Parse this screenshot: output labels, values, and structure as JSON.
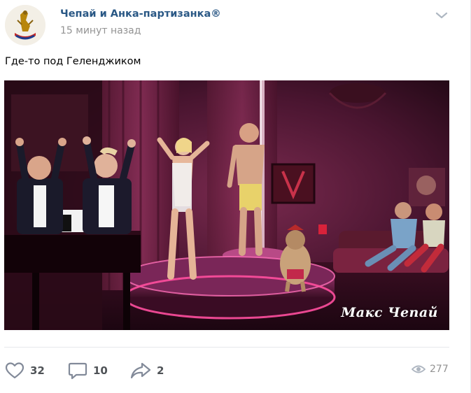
{
  "post": {
    "author": "Чепай и Анка-партизанка®",
    "time": "15 минут назад",
    "text": "Где-то под Геленджиком",
    "media": {
      "caption": "Макс Чепай"
    },
    "actions": {
      "likes": "32",
      "comments": "10",
      "shares": "2",
      "views": "277"
    }
  },
  "icons": {
    "avatar": "coat-of-arms-avatar",
    "menu": "chevron-down-icon",
    "like": "heart-icon",
    "comment": "comment-icon",
    "share": "share-arrow-icon",
    "views": "eye-icon"
  },
  "colors": {
    "author": "#2a5885",
    "muted": "#939393",
    "action_icon": "#828a99",
    "action_text": "#4f5357"
  }
}
